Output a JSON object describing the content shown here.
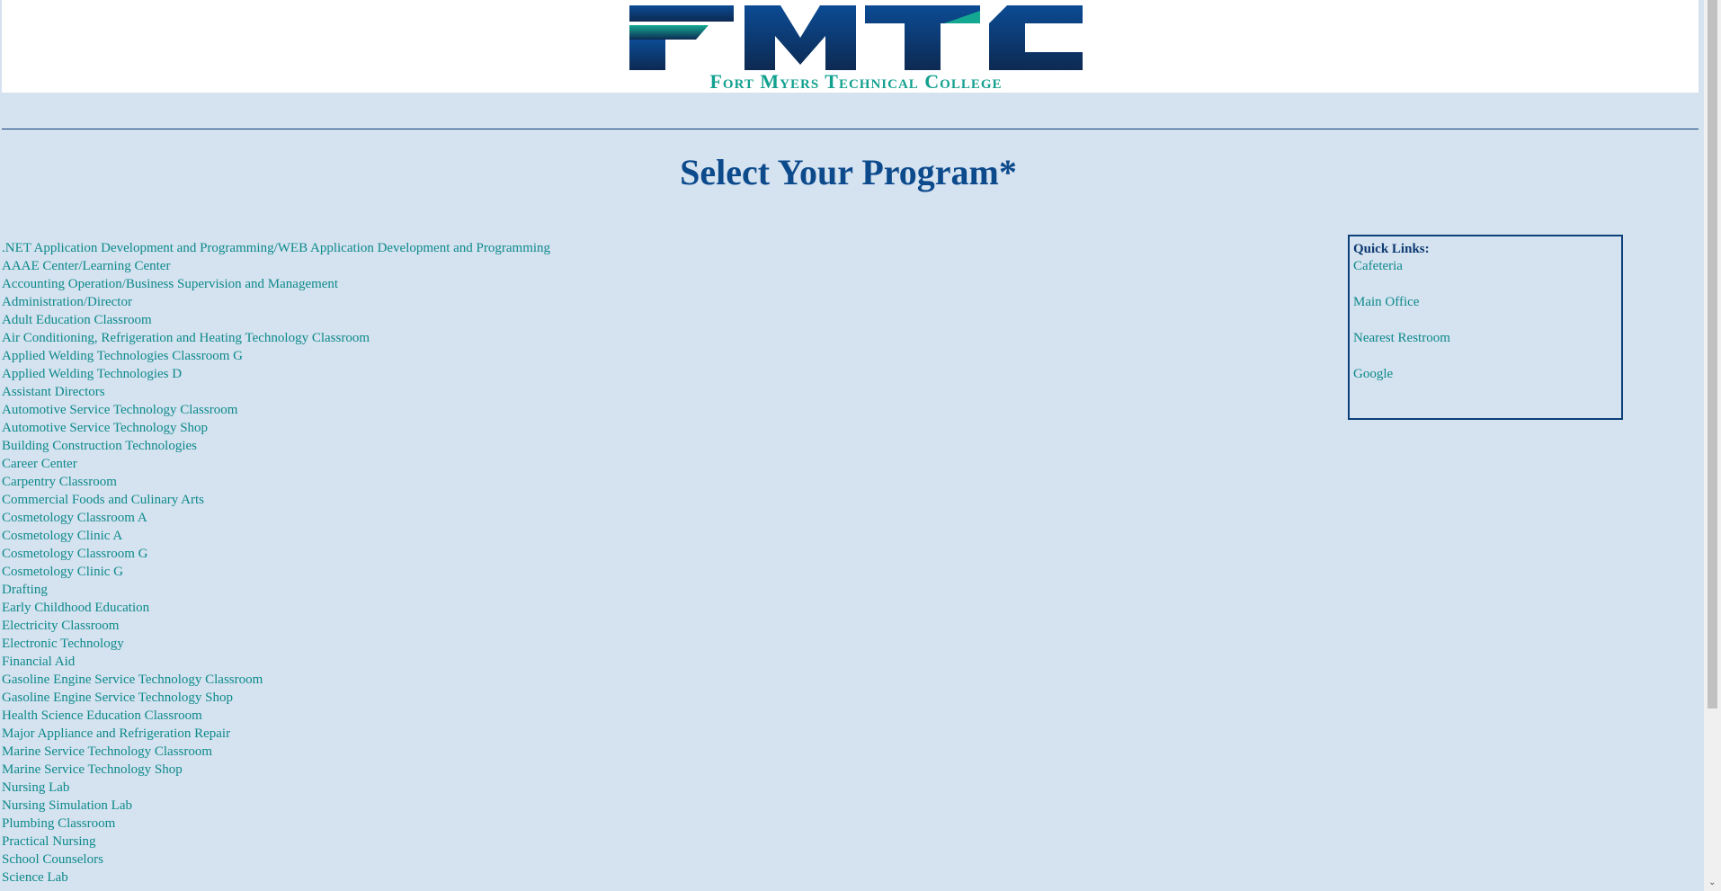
{
  "header": {
    "logo_letters": "FMTC",
    "logo_subtitle": "Fort Myers Technical College",
    "colors": {
      "navy": "#0d3f7a",
      "teal": "#13a08f"
    }
  },
  "page_title": "Select Your Program*",
  "programs": [
    ".NET Application Development and Programming/WEB Application Development and Programming",
    "AAAE Center/Learning Center",
    "Accounting Operation/Business Supervision and Management",
    "Administration/Director",
    "Adult Education Classroom",
    "Air Conditioning, Refrigeration and Heating Technology Classroom",
    "Applied Welding Technologies Classroom G",
    "Applied Welding Technologies D",
    "Assistant Directors",
    "Automotive Service Technology Classroom",
    "Automotive Service Technology Shop",
    "Building Construction Technologies",
    "Career Center",
    "Carpentry Classroom",
    "Commercial Foods and Culinary Arts",
    "Cosmetology Classroom A",
    "Cosmetology Clinic A",
    "Cosmetology Classroom G",
    "Cosmetology Clinic G",
    "Drafting",
    "Early Childhood Education",
    "Electricity Classroom",
    "Electronic Technology",
    "Financial Aid",
    "Gasoline Engine Service Technology Classroom",
    "Gasoline Engine Service Technology Shop",
    "Health Science Education Classroom",
    "Major Appliance and Refrigeration Repair",
    "Marine Service Technology Classroom",
    "Marine Service Technology Shop",
    "Nursing Lab",
    "Nursing Simulation Lab",
    "Plumbing Classroom",
    "Practical Nursing",
    "School Counselors",
    "Science Lab"
  ],
  "quick_links": {
    "title": "Quick Links:",
    "items": [
      "Cafeteria",
      "Main Office",
      "Nearest Restroom",
      "Google"
    ]
  },
  "scrollbar": {
    "down_arrow_icon": "chevron-down-icon",
    "scroll_fraction_visible": 0.8
  }
}
